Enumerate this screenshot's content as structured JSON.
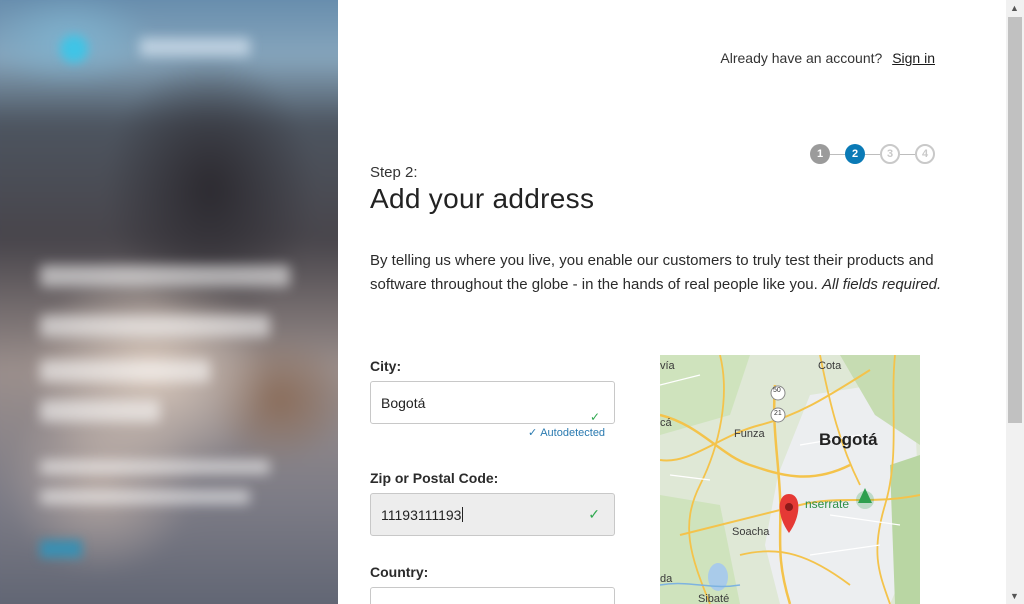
{
  "header": {
    "signin_prompt": "Already have an account?",
    "signin_link": "Sign in"
  },
  "steps": [
    {
      "label": "1",
      "state": "done"
    },
    {
      "label": "2",
      "state": "active"
    },
    {
      "label": "3",
      "state": "todo"
    },
    {
      "label": "4",
      "state": "todo"
    }
  ],
  "form": {
    "step_label": "Step 2:",
    "title": "Add your address",
    "intro": "By telling us where you live, you enable our customers to truly test their products and software throughout the globe - in the hands of real people like you.",
    "intro_emphasis": "All fields required.",
    "city": {
      "label": "City:",
      "value": "Bogotá",
      "hint": "Autodetected",
      "hint_icon": "check-icon"
    },
    "zip": {
      "label": "Zip or Postal Code:",
      "value": "11193111193",
      "icon": "check-icon"
    },
    "country": {
      "label": "Country:",
      "value": ""
    }
  },
  "map": {
    "city": "Bogotá",
    "places": [
      "Cota",
      "Funza",
      "Soacha",
      "Sibaté",
      "vía",
      "cá",
      "da"
    ],
    "landmark": "Monserrate",
    "landmark_visible": "nserrate",
    "road_shields": [
      "50",
      "21"
    ],
    "marker_color": "#e53935"
  },
  "colors": {
    "accent": "#0a7ab6",
    "success": "#2fa84f"
  }
}
